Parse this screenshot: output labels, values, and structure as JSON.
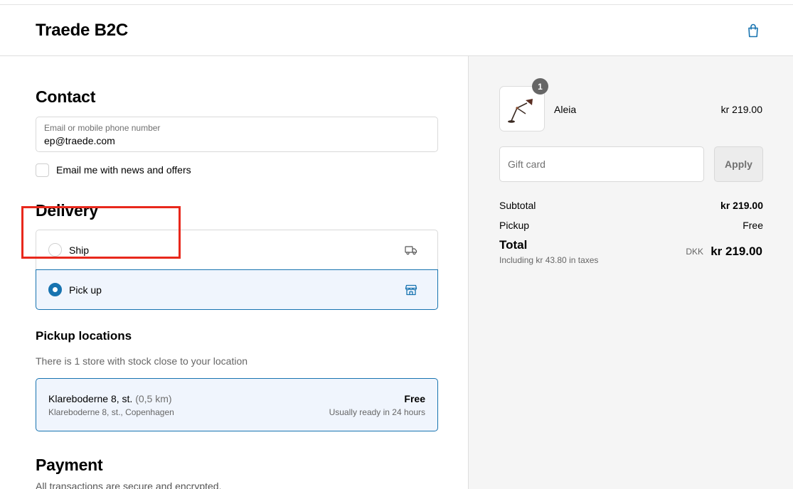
{
  "header": {
    "store_name": "Traede B2C",
    "cart_icon": "shopping-bag-icon"
  },
  "contact": {
    "title": "Contact",
    "email_label": "Email or mobile phone number",
    "email_value": "ep@traede.com",
    "newsletter_label": "Email me with news and offers",
    "newsletter_checked": false
  },
  "delivery": {
    "title": "Delivery",
    "options": [
      {
        "label": "Ship",
        "icon": "truck-icon",
        "selected": false
      },
      {
        "label": "Pick up",
        "icon": "store-icon",
        "selected": true
      }
    ]
  },
  "pickup": {
    "title": "Pickup locations",
    "note": "There is 1 store with stock close to your location",
    "location": {
      "name": "Klareboderne 8, st.",
      "distance": "(0,5 km)",
      "address": "Klareboderne 8, st., Copenhagen",
      "price": "Free",
      "ready": "Usually ready in 24 hours"
    }
  },
  "payment": {
    "title": "Payment",
    "note": "All transactions are secure and encrypted."
  },
  "summary": {
    "product": {
      "name": "Aleia",
      "price": "kr 219.00",
      "quantity": "1"
    },
    "gift_card_placeholder": "Gift card",
    "apply_label": "Apply",
    "subtotal_label": "Subtotal",
    "subtotal_value": "kr 219.00",
    "pickup_label": "Pickup",
    "pickup_value": "Free",
    "total_label": "Total",
    "tax_note": "Including kr 43.80 in taxes",
    "currency": "DKK",
    "total_value": "kr 219.00"
  },
  "colors": {
    "accent": "#1773b0",
    "highlight": "#e8281c",
    "selected_bg": "#f0f5fd"
  }
}
